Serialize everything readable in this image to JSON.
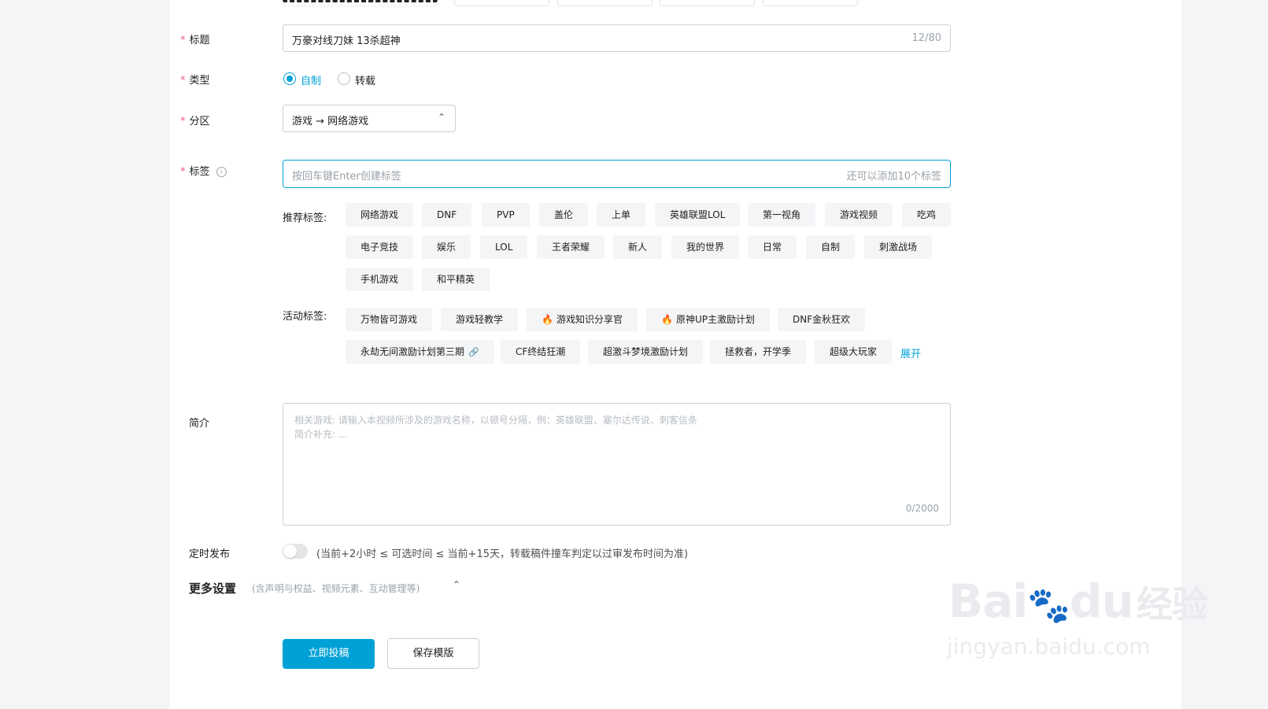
{
  "form": {
    "title_label": "标题",
    "title_value": "万豪对线刀妹 13杀超神",
    "title_count": "12/80",
    "type_label": "类型",
    "type_options": [
      "自制",
      "转载"
    ],
    "zone_label": "分区",
    "zone_value": "游戏 → 网络游戏",
    "tags_label": "标签",
    "tags_placeholder": "按回车键Enter创建标签",
    "tags_hint": "还可以添加10个标签",
    "recommended_label": "推荐标签:",
    "recommended_tags": [
      "网络游戏",
      "DNF",
      "PVP",
      "盖伦",
      "上单",
      "英雄联盟LOL",
      "第一视角",
      "游戏视频",
      "吃鸡",
      "电子竞技",
      "娱乐",
      "LOL",
      "王者荣耀",
      "新人",
      "我的世界",
      "日常",
      "自制",
      "刺激战场",
      "手机游戏",
      "和平精英"
    ],
    "activity_label": "活动标签:",
    "activity_tags": [
      "万物皆可游戏",
      "游戏轻教学",
      "游戏知识分享官",
      "原神UP主激励计划",
      "DNF金秋狂欢",
      "永劫无间激励计划第三期",
      "CF终结狂潮",
      "超激斗梦境激励计划",
      "拯救者，开学季",
      "超级大玩家"
    ],
    "expand_link": "展开",
    "intro_label": "简介",
    "intro_placeholder_line1": "相关游戏: 请输入本视频所涉及的游戏名称，以顿号分隔，例：英雄联盟、塞尔达传说、刺客信条",
    "intro_placeholder_line2": "简介补充: ...",
    "intro_count": "0/2000",
    "schedule_label": "定时发布",
    "schedule_hint": "(当前+2小时 ≤ 可选时间 ≤ 当前+15天，转载稿件撞车判定以过审发布时间为准)",
    "more_label": "更多设置",
    "more_hint": "(含声明与权益、视频元素、互动管理等)",
    "submit_button": "立即投稿",
    "save_template_button": "保存模版"
  },
  "watermark": {
    "brand": "Bai",
    "brand2": "du",
    "cn": "经验",
    "url": "jingyan.baidu.com"
  },
  "colors": {
    "accent": "#00a1d6",
    "required": "#f25d8e",
    "tag_bg": "#f4f5f7",
    "fire": "#f5582b"
  }
}
